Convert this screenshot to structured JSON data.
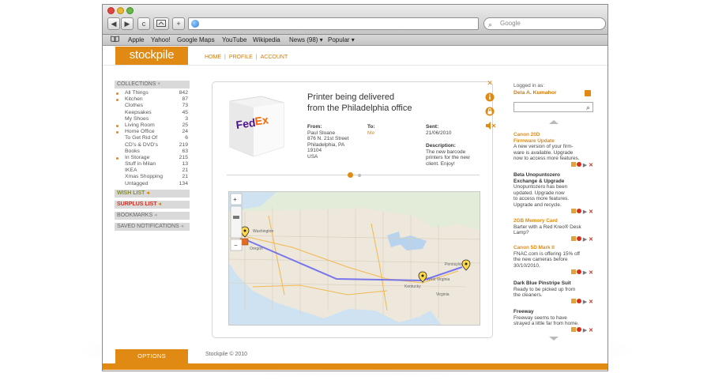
{
  "browser": {
    "search_placeholder": "Google",
    "nav": {
      "back": "◀",
      "forward": "▶",
      "reload": "c",
      "plus": "+"
    },
    "bookmarks": [
      "Apple",
      "Yahoo!",
      "Google Maps",
      "YouTube",
      "Wikipedia",
      "News (98) ▾",
      "Popular ▾"
    ]
  },
  "app": {
    "logo": "stockpile",
    "nav": [
      "HOME",
      "PROFILE",
      "ACCOUNT"
    ],
    "collections_header": "COLLECTIONS",
    "collections": [
      {
        "name": "All Things",
        "count": "842",
        "dot": true
      },
      {
        "name": "Kitchen",
        "count": "87",
        "dot": true
      },
      {
        "name": "Clothes",
        "count": "73",
        "dot": false
      },
      {
        "name": "Keepsakes",
        "count": "45",
        "dot": false
      },
      {
        "name": "My Shoes",
        "count": "3",
        "dot": false
      },
      {
        "name": "Living Room",
        "count": "25",
        "dot": true
      },
      {
        "name": "Home Office",
        "count": "24",
        "dot": true
      },
      {
        "name": "To Get Rid Of",
        "count": "6",
        "dot": false
      },
      {
        "name": "CD's & DVD's",
        "count": "219",
        "dot": false
      },
      {
        "name": "Books",
        "count": "63",
        "dot": false
      },
      {
        "name": "In Storage",
        "count": "215",
        "dot": true
      },
      {
        "name": "Stuff in Milan",
        "count": "13",
        "dot": false
      },
      {
        "name": "IKEA",
        "count": "21",
        "dot": false
      },
      {
        "name": "Xmas Shopping",
        "count": "21",
        "dot": false
      },
      {
        "name": "Untagged",
        "count": "134",
        "dot": false
      }
    ],
    "wish_list": "WISH LIST",
    "surplus_list": "SURPLUS LIST",
    "bookmarks_label": "BOOKMARKS",
    "saved_notifications": "SAVED NOTIFICATIONS",
    "options": "OPTIONS",
    "copyright": "Stockpile © 2010"
  },
  "detail": {
    "title_line1": "Printer being delivered",
    "title_line2": "from the Philadelphia office",
    "from_label": "From:",
    "from_lines": [
      "Paul Sloane",
      "876 N. 21st Street",
      "Philadelphia, PA",
      "19104",
      "USA"
    ],
    "to_label": "To:",
    "to_value": "Me",
    "sent_label": "Sent:",
    "sent_value": "21/06/2010",
    "desc_label": "Description:",
    "desc_lines": [
      "The new barcode",
      "printers for the new",
      "client. Enjoy!"
    ],
    "map_labels": {
      "oregon": "Oregon",
      "washington": "Washington",
      "kentucky": "Kentucky",
      "virginia": "Virginia",
      "west_virginia": "West Virginia",
      "pennsylvania": "Pennsylvania"
    }
  },
  "sidebar": {
    "logged_in_label": "Logged in as:",
    "username": "Dela A. Kumahor",
    "feed": [
      {
        "title": "Canon 20D",
        "title2": "Firmware Update",
        "style": "orange",
        "lines": [
          "A new version of your firm-",
          "ware is available. Upgrade",
          "now to access more features."
        ]
      },
      {
        "title": "Beta Unopuntozero",
        "title2": "Exchange & Upgrade",
        "style": "dark",
        "lines": [
          "Unopuntozero has been",
          "updated. Upgrade now",
          "to access more features.",
          "Upgrade and recycle."
        ]
      },
      {
        "title": "2GB Memory Card",
        "title2": "",
        "style": "orange",
        "lines": [
          "Barter with a Red Kreo® Desk",
          "Lamp?"
        ]
      },
      {
        "title": "Canon 5D Mark II",
        "title2": "",
        "style": "orange",
        "lines": [
          "FNAC.com is offering 15% off",
          "the new cameras before",
          "30/10/2010."
        ]
      },
      {
        "title": "Dark Blue Pinstripe Suit",
        "title2": "",
        "style": "dark",
        "lines": [
          "Ready to be picked up from",
          "the cleaners."
        ]
      },
      {
        "title": "Freeway",
        "title2": "",
        "style": "dark",
        "lines": [
          "Freeway seems to have",
          "strayed a little far from home."
        ]
      }
    ]
  },
  "colors": {
    "accent": "#e08a14",
    "olive": "#8a8d1f"
  },
  "icons": {
    "rss": "rss-icon",
    "search": "search-icon",
    "close": "close-icon",
    "mute": "mute-icon"
  }
}
